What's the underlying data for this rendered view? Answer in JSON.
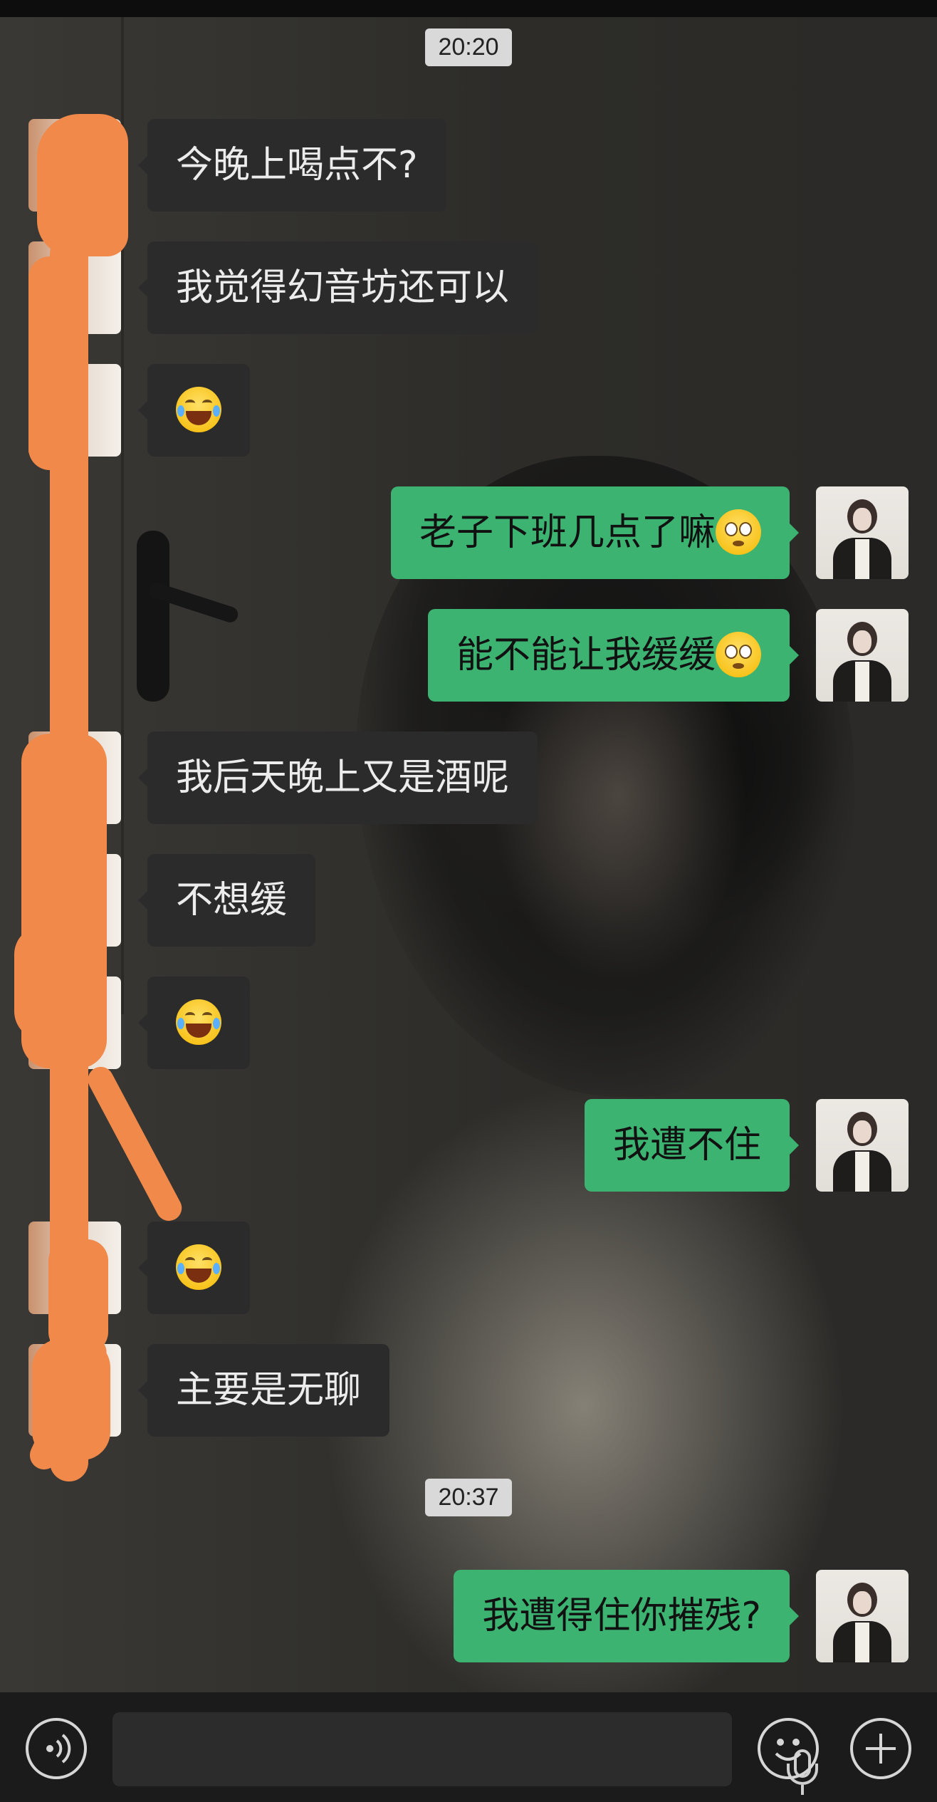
{
  "timestamps": [
    "20:20",
    "20:37"
  ],
  "messages": [
    {
      "side": "left",
      "text": "今晚上喝点不?",
      "emoji": ""
    },
    {
      "side": "left",
      "text": "我觉得幻音坊还可以",
      "emoji": ""
    },
    {
      "side": "left",
      "text": "",
      "emoji": "laugh"
    },
    {
      "side": "right",
      "text": "老子下班几点了嘛",
      "emoji": "flushed"
    },
    {
      "side": "right",
      "text": "能不能让我缓缓",
      "emoji": "flushed"
    },
    {
      "side": "left",
      "text": "我后天晚上又是酒呢",
      "emoji": ""
    },
    {
      "side": "left",
      "text": "不想缓",
      "emoji": ""
    },
    {
      "side": "left",
      "text": "",
      "emoji": "laugh"
    },
    {
      "side": "right",
      "text": "我遭不住",
      "emoji": ""
    },
    {
      "side": "left",
      "text": "",
      "emoji": "laugh"
    },
    {
      "side": "left",
      "text": "主要是无聊",
      "emoji": ""
    },
    {
      "side": "right",
      "text": "我遭得住你摧残?",
      "emoji": ""
    }
  ],
  "input_bar": {
    "voice_icon": "voice-toggle-icon",
    "mic_icon": "microphone-icon",
    "emoji_icon": "emoji-smiley-icon",
    "plus_icon": "plus-icon"
  },
  "colors": {
    "outgoing_bubble": "#3cb371",
    "incoming_bubble": "#2b2b2b",
    "timestamp_bg": "#d9d9d9",
    "redaction": "#f0894a"
  }
}
